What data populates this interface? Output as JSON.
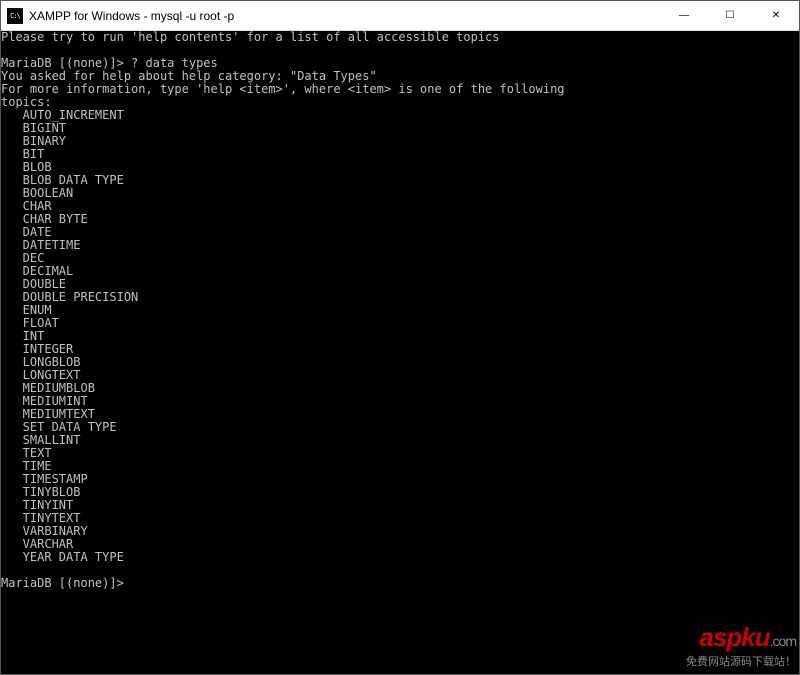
{
  "window": {
    "title": "XAMPP for Windows - mysql -u root -p"
  },
  "controls": {
    "minimize": "—",
    "maximize": "☐",
    "close": "✕"
  },
  "terminal": {
    "line_help_hint": "Please try to run 'help contents' for a list of all accessible topics",
    "blank1": "",
    "prompt1": "MariaDB [(none)]> ? data types",
    "asked": "You asked for help about help category: \"Data Types\"",
    "moreinfo": "For more information, type 'help <item>', where <item> is one of the following",
    "topics_label": "topics:",
    "topics": [
      "AUTO_INCREMENT",
      "BIGINT",
      "BINARY",
      "BIT",
      "BLOB",
      "BLOB DATA TYPE",
      "BOOLEAN",
      "CHAR",
      "CHAR BYTE",
      "DATE",
      "DATETIME",
      "DEC",
      "DECIMAL",
      "DOUBLE",
      "DOUBLE PRECISION",
      "ENUM",
      "FLOAT",
      "INT",
      "INTEGER",
      "LONGBLOB",
      "LONGTEXT",
      "MEDIUMBLOB",
      "MEDIUMINT",
      "MEDIUMTEXT",
      "SET DATA TYPE",
      "SMALLINT",
      "TEXT",
      "TIME",
      "TIMESTAMP",
      "TINYBLOB",
      "TINYINT",
      "TINYTEXT",
      "VARBINARY",
      "VARCHAR",
      "YEAR DATA TYPE"
    ],
    "blank2": "",
    "prompt2": "MariaDB [(none)]>"
  },
  "watermark": {
    "brand_a": "a",
    "brand_s": "s",
    "brand_p": "p",
    "brand_k": "k",
    "brand_u": "u",
    "brand_dotcom": ".com",
    "subtitle": "免费网站源码下载站！"
  }
}
